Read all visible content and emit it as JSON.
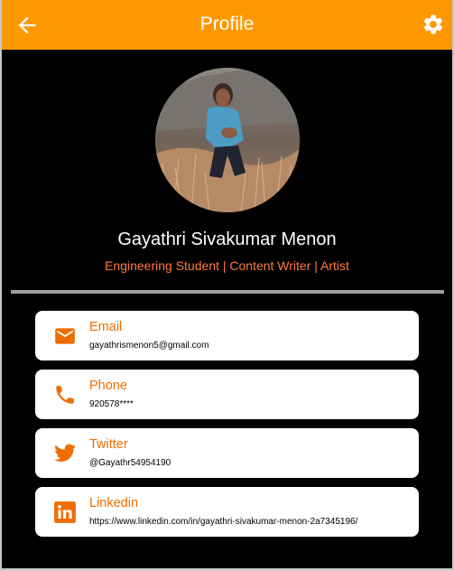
{
  "appbar": {
    "title": "Profile",
    "back_icon": "arrow-back-icon",
    "settings_icon": "gear-icon",
    "color": "#FF9800"
  },
  "profile": {
    "name": "Gayathri Sivakumar Menon",
    "tagline": "Engineering Student | Content Writer | Artist",
    "tagline_color": "#FF7A3D"
  },
  "contacts": [
    {
      "label": "Email",
      "value": "gayathrismenon5@gmail.com",
      "icon": "email-icon"
    },
    {
      "label": "Phone",
      "value": "920578****",
      "icon": "phone-icon"
    },
    {
      "label": "Twitter",
      "value": "@Gayathr54954190",
      "icon": "twitter-icon"
    },
    {
      "label": "Linkedin",
      "value": "https://www.linkedin.com/in/gayathri-sivakumar-menon-2a7345196/",
      "icon": "linkedin-icon"
    }
  ],
  "colors": {
    "accent": "#EF6C00",
    "background": "#000000",
    "card": "#FFFFFF"
  }
}
